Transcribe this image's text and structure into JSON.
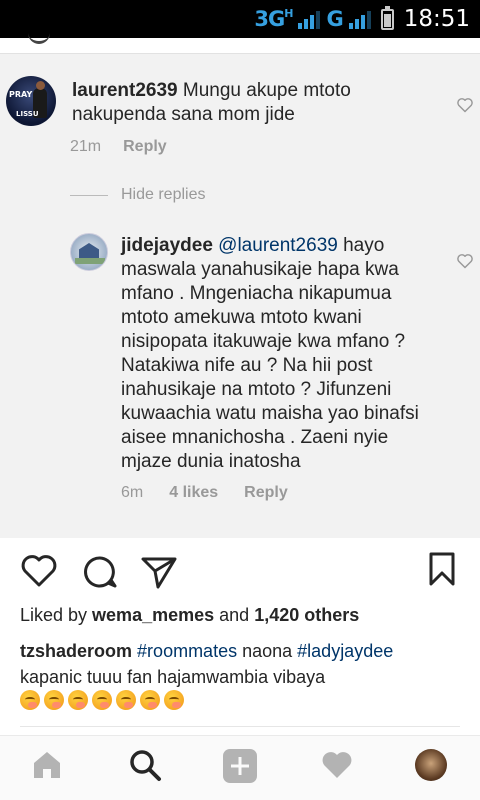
{
  "status_bar": {
    "network_1": "3G",
    "network_1_sup": "H",
    "network_2": "G",
    "time": "18:51",
    "colors": {
      "background": "#000000",
      "network": "#36a0e0",
      "text": "#ffffff"
    }
  },
  "comments": [
    {
      "username": "laurent2639",
      "text": " Mungu akupe mtoto nakupenda sana mom jide",
      "time": "21m",
      "reply_label": "Reply"
    }
  ],
  "hide_replies_label": "Hide replies",
  "reply": {
    "username": "jidejaydee",
    "mention": "@laurent2639",
    "text": " hayo maswala yanahusikaje hapa kwa mfano . Mngeniacha nikapumua mtoto amekuwa mtoto kwani nisipopata itakuwaje kwa mfano ? Natakiwa nife au ? Na hii post inahusikaje na mtoto ? Jifunzeni kuwaachia watu maisha yao binafsi aisee mnanichosha . Zaeni nyie mjaze dunia inatosha",
    "time": "6m",
    "likes": "4 likes",
    "reply_label": "Reply"
  },
  "post": {
    "liked_by_prefix": "Liked by ",
    "liked_by_user": "wema_memes",
    "liked_by_mid": " and ",
    "liked_by_count": "1,420 others",
    "caption_user": "tzshaderoom",
    "hashtag_1": "#roommates",
    "caption_mid": " naona ",
    "hashtag_2": "#ladyjaydee",
    "caption_rest": "kapanic tuuu fan hajamwambia vibaya",
    "emoji_count": 7,
    "emoji_name": "face-blowing-kiss-icon"
  },
  "nav": {
    "items": [
      "home-icon",
      "search-icon",
      "add-icon",
      "activity-heart-icon",
      "profile-avatar"
    ]
  },
  "colors": {
    "link": "#003569",
    "muted": "#999999",
    "text": "#262626",
    "screenshot_bg": "#f2f2f2"
  }
}
